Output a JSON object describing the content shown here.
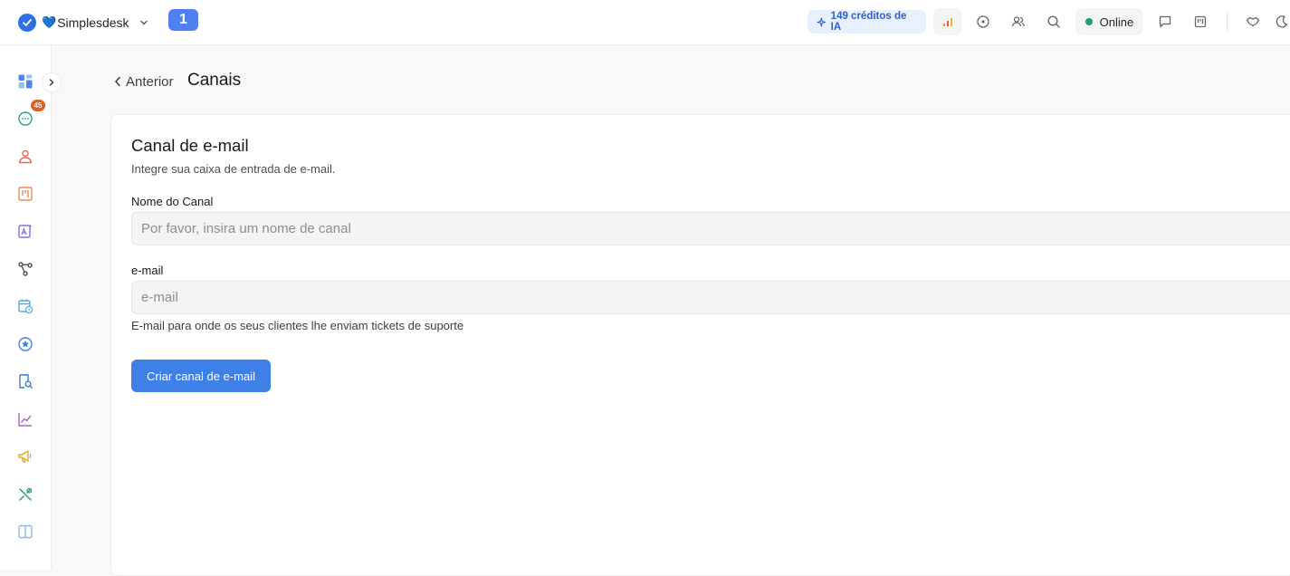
{
  "header": {
    "brand_heart": "💙",
    "brand_name": "Simplesdesk",
    "tab_number": "1",
    "credits_label": "149 créditos de IA",
    "status_label": "Online",
    "colors": {
      "accent": "#3f7fe8",
      "status_online": "#22a06b",
      "credits_bg": "#e9f0fd"
    }
  },
  "sidebar": {
    "items": [
      {
        "icon": "dashboard-icon"
      },
      {
        "icon": "conversations-icon",
        "badge": "45"
      },
      {
        "icon": "customers-icon"
      },
      {
        "icon": "kanban-icon"
      },
      {
        "icon": "ai-agent-icon"
      },
      {
        "icon": "workflow-icon"
      },
      {
        "icon": "calendar-clock-icon"
      },
      {
        "icon": "star-circle-icon"
      },
      {
        "icon": "knowledge-search-icon"
      },
      {
        "icon": "reports-chart-icon"
      },
      {
        "icon": "campaigns-megaphone-icon"
      },
      {
        "icon": "tools-icon"
      },
      {
        "icon": "book-icon"
      }
    ]
  },
  "page": {
    "back_label": "Anterior",
    "title": "Canais"
  },
  "form": {
    "title": "Canal de e-mail",
    "subtitle": "Integre sua caixa de entrada de e-mail.",
    "name_label": "Nome do Canal",
    "name_placeholder": "Por favor, insira um nome de canal",
    "email_label": "e-mail",
    "email_placeholder": "e-mail",
    "email_help": "E-mail para onde os seus clientes lhe enviam tickets de suporte",
    "submit_label": "Criar canal de e-mail"
  }
}
